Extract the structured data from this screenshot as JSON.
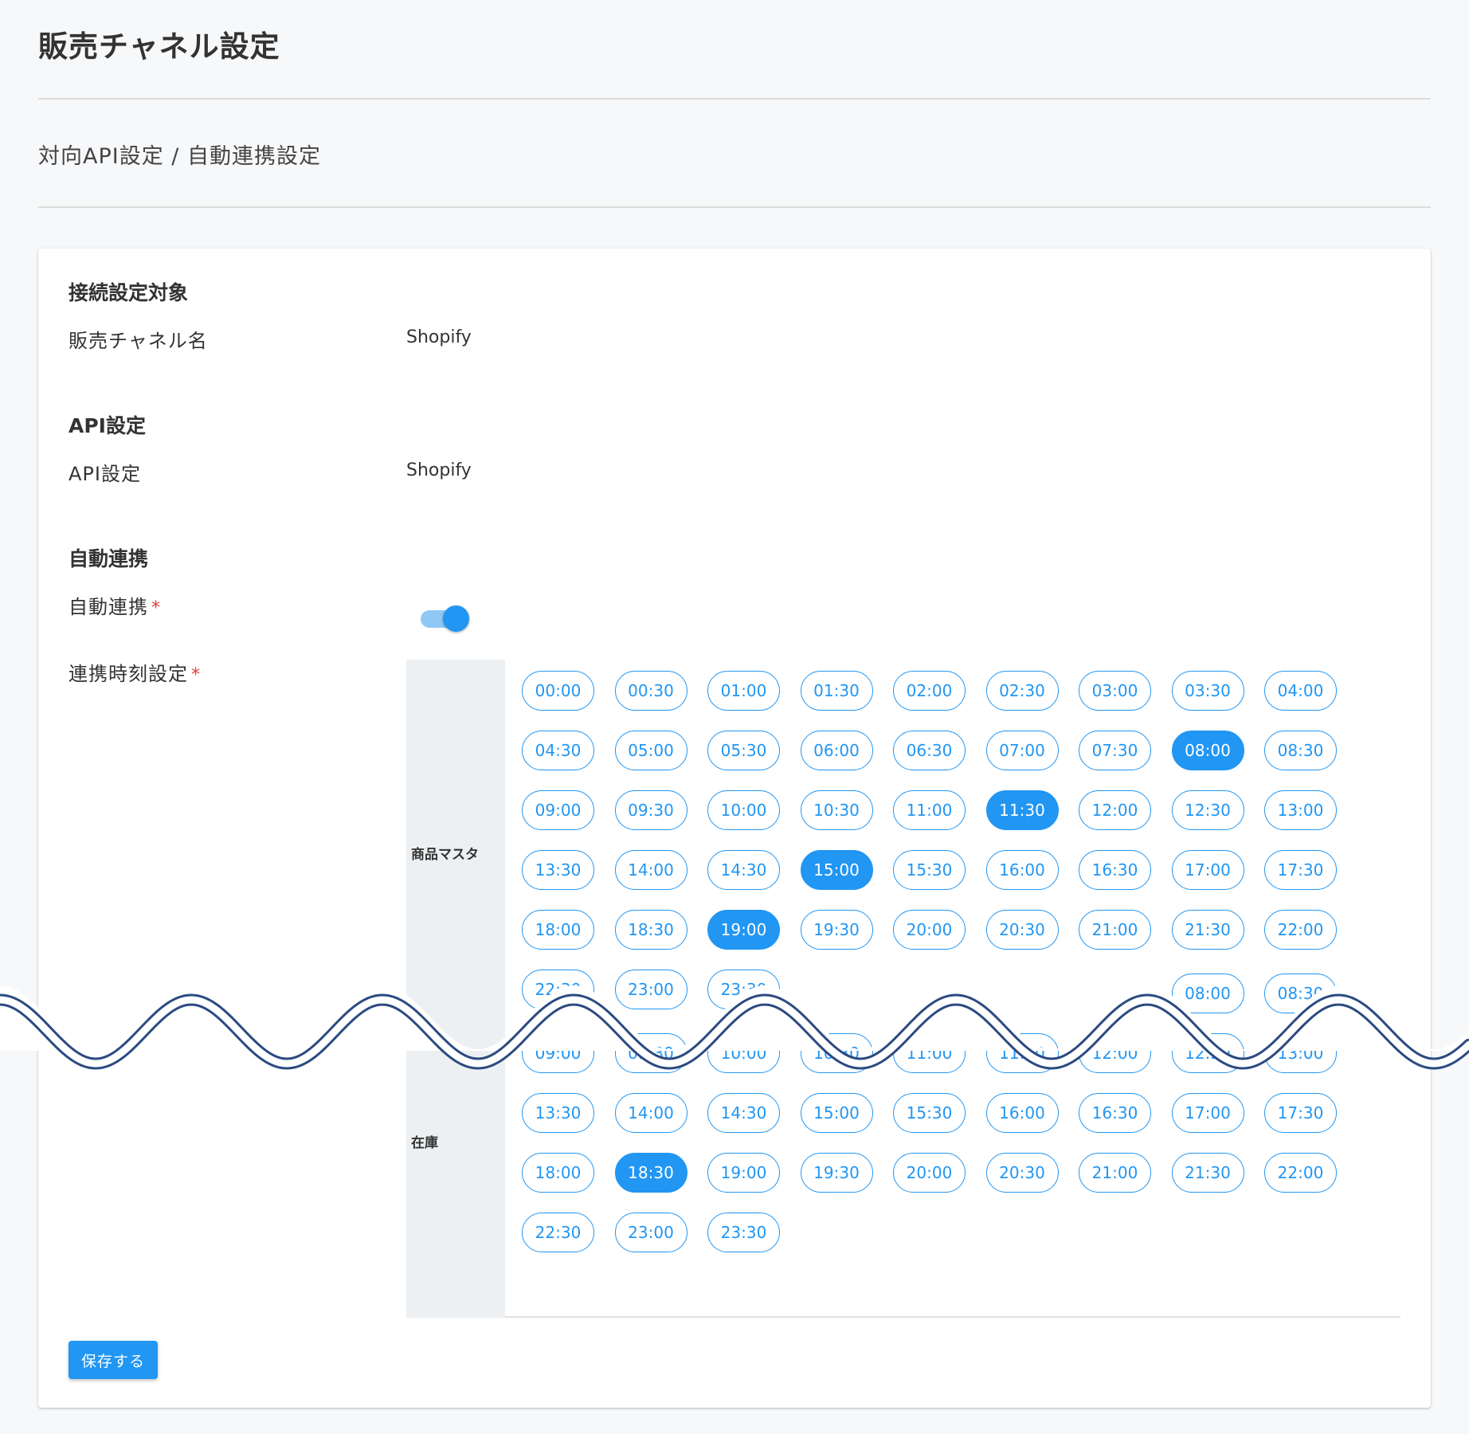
{
  "page": {
    "title": "販売チャネル設定",
    "breadcrumb": "対向API設定 / 自動連携設定"
  },
  "connection": {
    "heading": "接続設定対象",
    "channel_label": "販売チャネル名",
    "channel_value": "Shopify"
  },
  "api": {
    "heading": "API設定",
    "label": "API設定",
    "value": "Shopify"
  },
  "auto_sync": {
    "heading": "自動連携",
    "toggle_label": "自動連携",
    "toggle_on": true,
    "schedule_label": "連携時刻設定",
    "required_mark": "*"
  },
  "schedule": {
    "groups": [
      {
        "name": "商品マスタ",
        "selected": [
          "08:00",
          "11:30",
          "15:00",
          "19:00"
        ]
      },
      {
        "name": "在庫",
        "selected": [
          "18:30"
        ]
      }
    ]
  },
  "actions": {
    "save_label": "保存する"
  },
  "colors": {
    "accent": "#2196f3",
    "accent_light": "#90c8f5",
    "required": "#e53935",
    "wave": "#2b4a80"
  }
}
